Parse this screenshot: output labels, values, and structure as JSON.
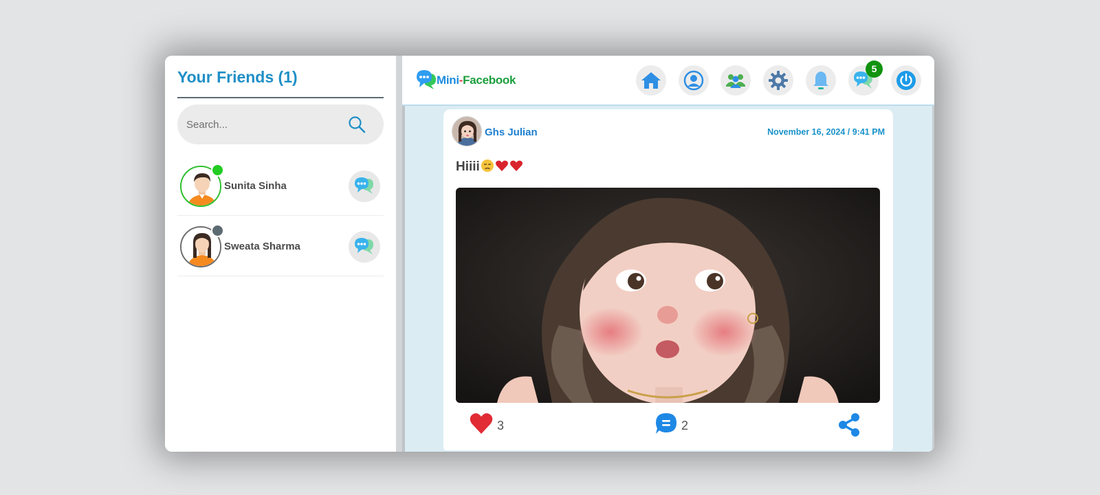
{
  "sidebar": {
    "title": "Your Friends (1)",
    "search_placeholder": "Search...",
    "friends": [
      {
        "name": "Sunita Sinha",
        "status": "online",
        "status_color": "#22cc22",
        "ring_color": "#2bbf2b"
      },
      {
        "name": "Sweata Sharma",
        "status": "offline",
        "status_color": "#5d6b73",
        "ring_color": "#6d6d6d"
      }
    ]
  },
  "header": {
    "logo_mini": "Mini",
    "logo_dash": "-",
    "logo_facebook": "Facebook",
    "nav_icons": [
      "home-icon",
      "profile-icon",
      "friends-icon",
      "settings-icon",
      "notifications-icon",
      "messages-icon",
      "power-icon"
    ],
    "messages_badge": "5"
  },
  "post": {
    "author": "Ghs Julian",
    "timestamp": "November 16, 2024 / 9:41 PM",
    "text": "Hiiii",
    "emojis": [
      "unamused-face",
      "red-heart",
      "red-heart"
    ],
    "likes": "3",
    "comments": "2"
  },
  "colors": {
    "accent": "#1f8fc6",
    "feed_background": "#dbecf3",
    "badge": "#11930f",
    "like": "#e12b35",
    "comment": "#1e88e5"
  }
}
